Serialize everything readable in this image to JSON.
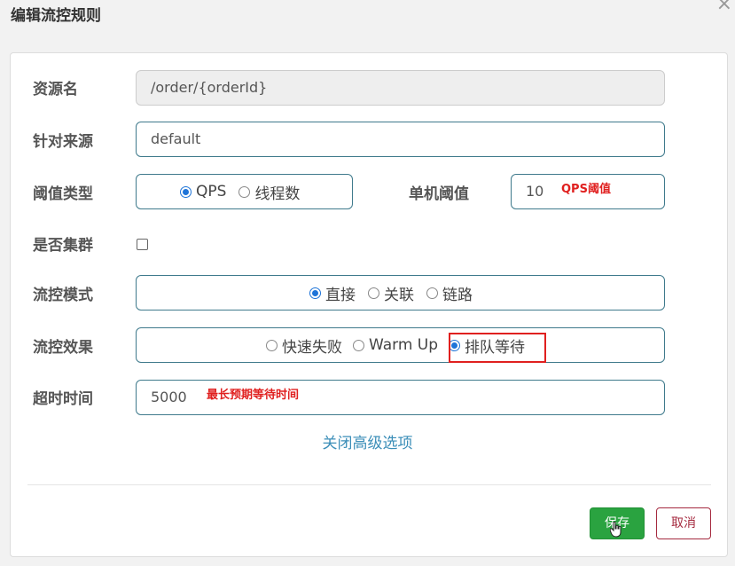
{
  "dialog": {
    "title": "编辑流控规则",
    "close_glyph": "×"
  },
  "form": {
    "resource_name": {
      "label": "资源名",
      "value": "/order/{orderId}"
    },
    "limit_app": {
      "label": "针对来源",
      "value": "default"
    },
    "threshold_type": {
      "label": "阈值类型",
      "options": [
        "QPS",
        "线程数"
      ],
      "selected": "QPS"
    },
    "single_threshold": {
      "label": "单机阈值",
      "value": "10",
      "hint": "QPS阈值"
    },
    "cluster": {
      "label": "是否集群",
      "checked": false
    },
    "flow_mode": {
      "label": "流控模式",
      "options": [
        "直接",
        "关联",
        "链路"
      ],
      "selected": "直接"
    },
    "flow_effect": {
      "label": "流控效果",
      "options": [
        "快速失败",
        "Warm Up",
        "排队等待"
      ],
      "selected": "排队等待"
    },
    "timeout": {
      "label": "超时时间",
      "value": "5000",
      "hint": "最长预期等待时间"
    },
    "advanced_toggle": "关闭高级选项"
  },
  "footer": {
    "save_label": "保存",
    "cancel_label": "取消"
  },
  "colors": {
    "accent": "#1e74d8",
    "save": "#2aa340",
    "cancel": "#a52a3f",
    "annotation": "#e0201f",
    "link": "#3b8eb8"
  }
}
